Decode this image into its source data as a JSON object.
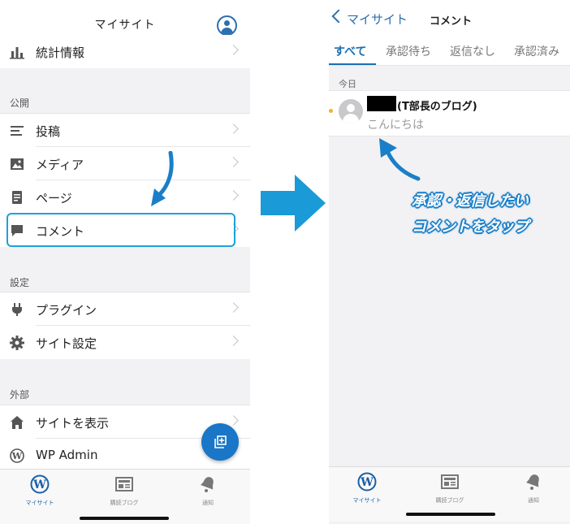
{
  "left": {
    "header": {
      "title": "マイサイト",
      "avatar_icon": "account-icon"
    },
    "top_item": {
      "label": "統計情報",
      "icon": "stats-icon"
    },
    "sections": {
      "publish": "公開",
      "settings": "設定",
      "external": "外部"
    },
    "publish_items": [
      {
        "label": "投稿",
        "icon": "posts-icon"
      },
      {
        "label": "メディア",
        "icon": "media-icon"
      },
      {
        "label": "ページ",
        "icon": "pages-icon"
      },
      {
        "label": "コメント",
        "icon": "comment-icon"
      }
    ],
    "settings_items": [
      {
        "label": "プラグイン",
        "icon": "plugin-icon"
      },
      {
        "label": "サイト設定",
        "icon": "gear-icon"
      }
    ],
    "external_items": [
      {
        "label": "サイトを表示",
        "icon": "home-icon"
      },
      {
        "label": "WP Admin",
        "icon": "wordpress-icon"
      }
    ],
    "fab_icon": "new-post-icon",
    "tabbar": [
      {
        "label": "マイサイト",
        "icon": "wordpress-icon"
      },
      {
        "label": "購読ブログ",
        "icon": "reader-icon"
      },
      {
        "label": "通知",
        "icon": "bell-icon"
      }
    ]
  },
  "right": {
    "header": {
      "back_label": "マイサイト",
      "title": "コメント"
    },
    "tabs": [
      "すべて",
      "承認待ち",
      "返信なし",
      "承認済み"
    ],
    "date_header": "今日",
    "comment": {
      "author": "(T部長のブログ)",
      "text": "こんにちは"
    },
    "annotation": [
      "承認・返信したい",
      "コメントをタップ"
    ],
    "tabbar": [
      {
        "label": "マイサイト",
        "icon": "wordpress-icon"
      },
      {
        "label": "購読ブログ",
        "icon": "reader-icon"
      },
      {
        "label": "通知",
        "icon": "bell-icon"
      }
    ]
  },
  "colors": {
    "accent": "#1a6fb5",
    "highlight": "#1da1d8",
    "arrow": "#1a9ad6",
    "unread": "#f0b429"
  }
}
